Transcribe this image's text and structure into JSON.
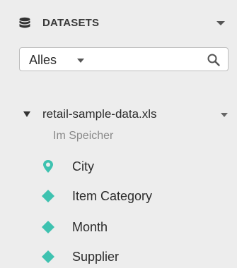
{
  "header": {
    "title": "DATASETS",
    "icon": "database-icon",
    "menu_icon": "chevron-down-icon"
  },
  "filter": {
    "value": "Alles",
    "caret_icon": "caret-down-icon",
    "search_icon": "search-icon"
  },
  "dataset": {
    "name": "retail-sample-data.xls",
    "subtitle": "Im Speicher",
    "expanded": true
  },
  "fields": [
    {
      "label": "City",
      "icon": "geo-pin-icon"
    },
    {
      "label": "Item Category",
      "icon": "dimension-diamond-icon"
    },
    {
      "label": "Month",
      "icon": "dimension-diamond-icon"
    },
    {
      "label": "Supplier",
      "icon": "dimension-diamond-icon"
    }
  ],
  "colors": {
    "accent": "#3ec2b0",
    "panel_bg": "#ededed",
    "muted_text": "#8a8a8a"
  }
}
